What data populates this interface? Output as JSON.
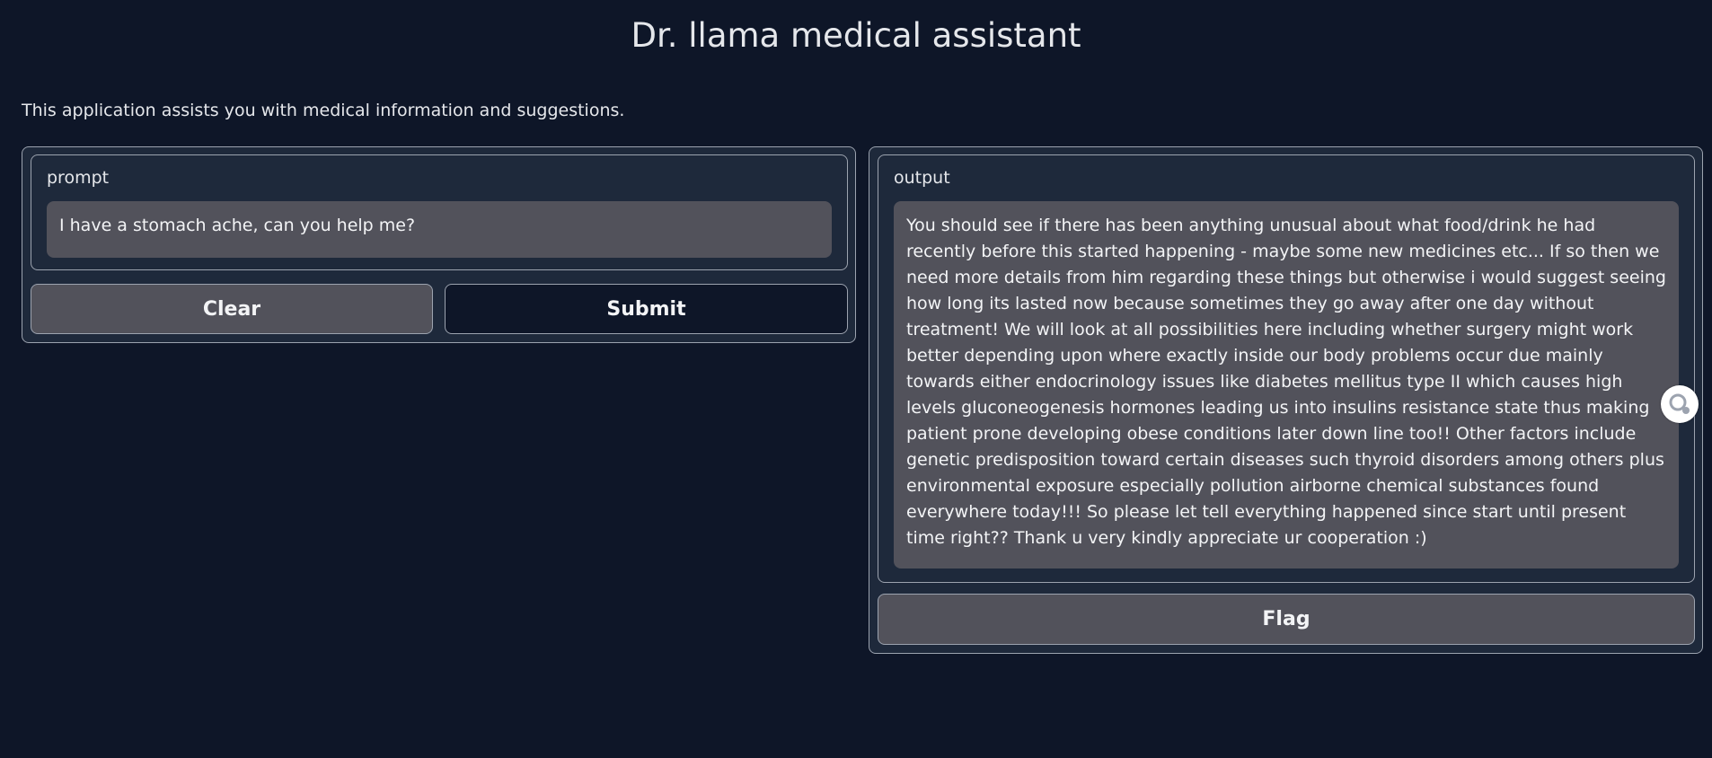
{
  "header": {
    "title": "Dr. llama medical assistant",
    "description": "This application assists you with medical information and suggestions."
  },
  "input_panel": {
    "prompt_label": "prompt",
    "prompt_value": "I have a stomach ache, can you help me?",
    "clear_label": "Clear",
    "submit_label": "Submit"
  },
  "output_panel": {
    "output_label": "output",
    "output_value": "You should see if there has been anything unusual about what food/drink he had recently before this started happening - maybe some new medicines etc... If so then we need more details from him regarding these things but otherwise i would suggest seeing how long its lasted now because sometimes they go away after one day without treatment! We will look at all possibilities here including whether surgery might work better depending upon where exactly inside our body problems occur due mainly towards either endocrinology issues like diabetes mellitus type II which causes high levels gluconeogenesis hormones leading us into insulins resistance state thus making patient prone developing obese conditions later down line too!! Other factors include genetic predisposition toward certain diseases such thyroid disorders among others plus environmental exposure especially pollution airborne chemical substances found everywhere today!!! So please let tell everything happened since start until present time right?? Thank u very kindly appreciate ur cooperation :)",
    "flag_label": "Flag"
  },
  "side_widget": {
    "icon": "assistant-bubble-icon"
  },
  "colors": {
    "background": "#0e1628",
    "panel": "#1e293b",
    "textbox": "#52525b",
    "border": "#9ca3af",
    "text": "#e5e7eb"
  }
}
